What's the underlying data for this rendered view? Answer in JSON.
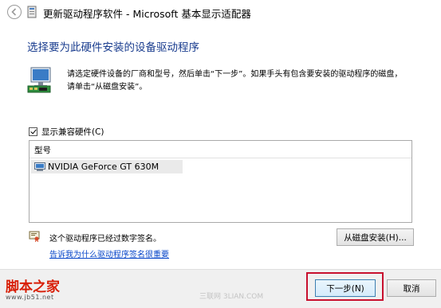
{
  "window": {
    "title": "更新驱动程序软件 - Microsoft 基本显示适配器"
  },
  "heading": "选择要为此硬件安装的设备驱动程序",
  "description": {
    "line1": "请选定硬件设备的厂商和型号，然后单击“下一步”。如果手头有包含要安装的驱动程序的磁盘，",
    "line2": "请单击“从磁盘安装”。"
  },
  "compatible": {
    "label": "显示兼容硬件(C)",
    "checked": true
  },
  "list": {
    "header": "型号",
    "items": [
      "NVIDIA GeForce GT 630M"
    ],
    "selected_index": 0
  },
  "signed_text": "这个驱动程序已经过数字签名。",
  "signature_link": "告诉我为什么驱动程序签名很重要",
  "buttons": {
    "have_disk": "从磁盘安装(H)...",
    "next": "下一步(N)",
    "cancel": "取消"
  },
  "watermark": {
    "logo": "脚本之家",
    "url": "www.jb51.net",
    "center": "三联网 3LIAN.COM"
  },
  "colors": {
    "heading": "#1a3d8f",
    "link": "#0645c9",
    "highlight": "#c8102e",
    "watermark": "#d81e06"
  }
}
